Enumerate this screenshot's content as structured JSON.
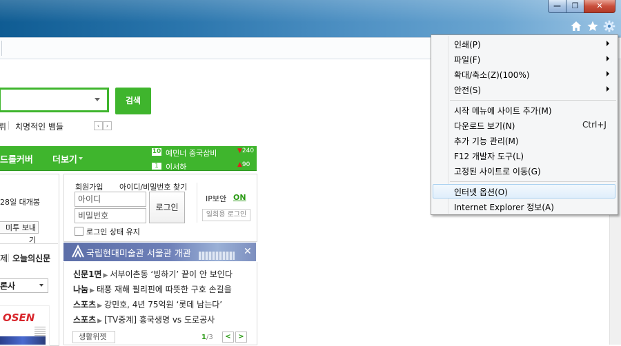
{
  "window": {
    "caption_buttons": {
      "minimize": "—",
      "maximize": "❐",
      "close": "✕"
    },
    "toolbar_icons": [
      "home-icon",
      "star-icon",
      "gear-icon"
    ]
  },
  "search": {
    "button_label": "검색"
  },
  "keywords": {
    "item1": "뤼",
    "item2": "치명적인 뱀들",
    "prev": "‹",
    "next": "›"
  },
  "nav": {
    "item_left": "드롤커버",
    "more": "더보기",
    "rank": [
      {
        "num": "10",
        "text": "예민너 중국삽비",
        "change": "240"
      },
      {
        "num": "1",
        "text": "이서하",
        "change": "90"
      }
    ]
  },
  "left_panel": {
    "date": "28일 대개봉",
    "send_button": "미투 보내기",
    "tab_a": "제",
    "tab_b": "오늘의신문",
    "press_select": "론사",
    "osen_logo": "OSEN"
  },
  "login": {
    "join": "회원가입",
    "find": "아이디/비밀번호 찾기",
    "id_placeholder": "아이디",
    "pw_placeholder": "비밀번호",
    "login_button": "로그인",
    "keep_login": "로그인 상태 유지",
    "ip_label": "IP보안",
    "ip_state": "ON",
    "otp_button": "일회용 로그인"
  },
  "banner": {
    "text": "국립현대미술관 서울관 개관",
    "close": "✕"
  },
  "news": [
    {
      "category": "신문1면",
      "headline": "서부이촌동 ‘빙하기’ 끝이 안 보인다"
    },
    {
      "category": "나눔",
      "headline": "태풍 재해 필리핀에 따뜻한 구호 손길을"
    },
    {
      "category": "스포츠",
      "headline": "강민호, 4년 75억원 ‘롯데 남는다’"
    },
    {
      "category": "스포츠",
      "headline": "[TV중계] 흥국생명 vs 도로공사"
    }
  ],
  "news_footer": {
    "widget_button": "생활위젯",
    "page_current": "1",
    "page_total": "/3",
    "prev": "<",
    "next": ">"
  },
  "tools_menu": {
    "items": [
      {
        "label": "인쇄(P)",
        "submenu": true
      },
      {
        "label": "파일(F)",
        "submenu": true
      },
      {
        "label": "확대/축소(Z)(100%)",
        "submenu": true
      },
      {
        "label": "안전(S)",
        "submenu": true
      },
      {
        "label": "시작 메뉴에 사이트 추가(M)"
      },
      {
        "label": "다운로드 보기(N)",
        "shortcut": "Ctrl+J"
      },
      {
        "label": "추가 기능 관리(M)"
      },
      {
        "label": "F12 개발자 도구(L)"
      },
      {
        "label": "고정된 사이트로 이동(G)"
      },
      {
        "label": "인터넷 옵션(O)",
        "highlighted": true
      },
      {
        "label": "Internet Explorer 정보(A)"
      }
    ]
  },
  "colors": {
    "brand_green": "#3fb52d",
    "menu_bg": "#f5f6f7",
    "highlight_border": "#a8d0f0"
  }
}
